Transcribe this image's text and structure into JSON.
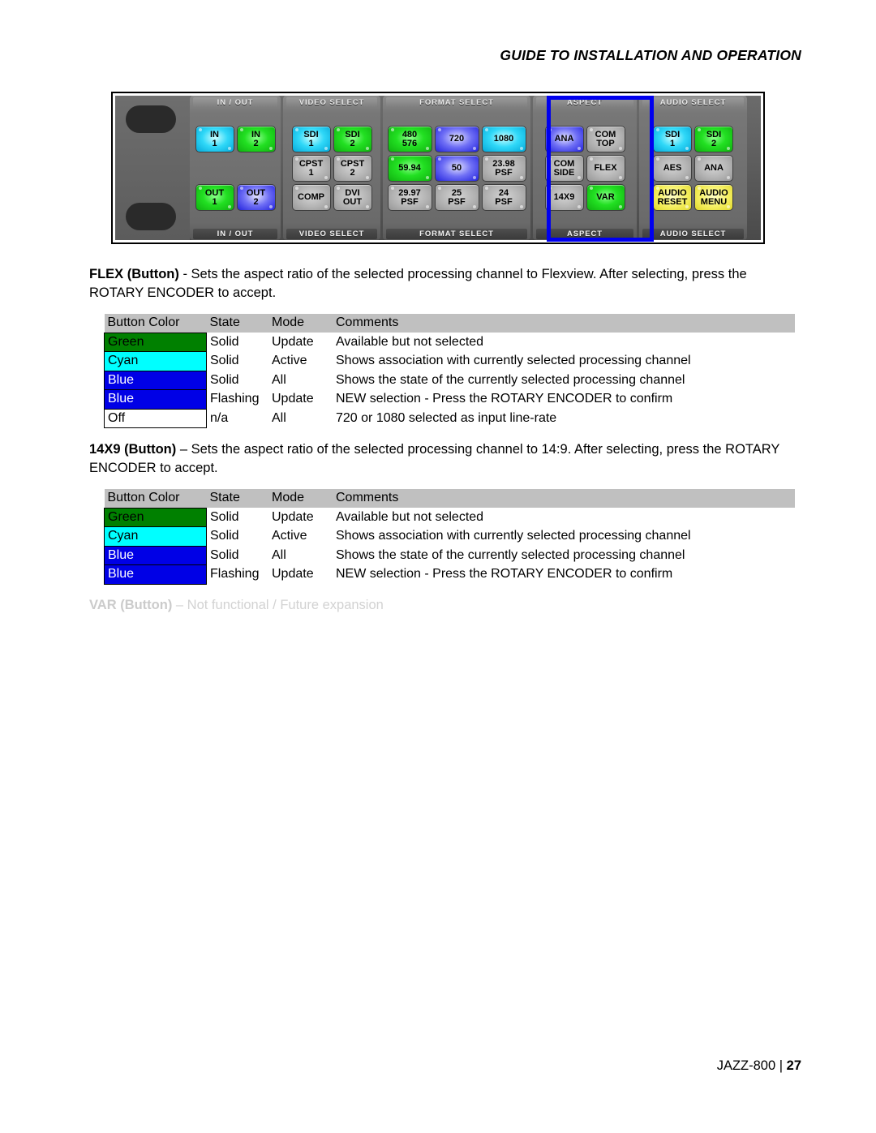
{
  "header": {
    "title": "GUIDE TO INSTALLATION AND OPERATION"
  },
  "footer": {
    "product": "JAZZ-800",
    "separator": "|",
    "page_number": "27"
  },
  "panel": {
    "highlighted_group": "ASPECT",
    "highlight_color": "#0000ee",
    "groups": [
      {
        "label": "IN / OUT",
        "columns": 2,
        "buttons": [
          {
            "lines": [
              "IN",
              "1"
            ],
            "color": "cyan"
          },
          {
            "lines": [
              "IN",
              "2"
            ],
            "color": "green"
          },
          {
            "lines": [],
            "color": "blank"
          },
          {
            "lines": [],
            "color": "blank"
          },
          {
            "lines": [
              "OUT",
              "1"
            ],
            "color": "green"
          },
          {
            "lines": [
              "OUT",
              "2"
            ],
            "color": "blue"
          }
        ]
      },
      {
        "label": "VIDEO SELECT",
        "columns": 2,
        "buttons": [
          {
            "lines": [
              "SDI",
              "1"
            ],
            "color": "cyan"
          },
          {
            "lines": [
              "SDI",
              "2"
            ],
            "color": "green"
          },
          {
            "lines": [
              "CPST",
              "1"
            ],
            "color": "off"
          },
          {
            "lines": [
              "CPST",
              "2"
            ],
            "color": "off"
          },
          {
            "lines": [
              "COMP"
            ],
            "color": "off"
          },
          {
            "lines": [
              "DVI",
              "OUT"
            ],
            "color": "off"
          }
        ]
      },
      {
        "label": "FORMAT SELECT",
        "columns": 3,
        "buttons": [
          {
            "lines": [
              "480",
              "576"
            ],
            "color": "green"
          },
          {
            "lines": [
              "720"
            ],
            "color": "blue"
          },
          {
            "lines": [
              "1080"
            ],
            "color": "cyan"
          },
          {
            "lines": [
              "59.94"
            ],
            "color": "green"
          },
          {
            "lines": [
              "50"
            ],
            "color": "blue"
          },
          {
            "lines": [
              "23.98",
              "PSF"
            ],
            "color": "off"
          },
          {
            "lines": [
              "29.97",
              "PSF"
            ],
            "color": "off"
          },
          {
            "lines": [
              "25",
              "PSF"
            ],
            "color": "off"
          },
          {
            "lines": [
              "24",
              "PSF"
            ],
            "color": "off"
          }
        ]
      },
      {
        "label": "ASPECT",
        "columns": 2,
        "buttons": [
          {
            "lines": [
              "ANA"
            ],
            "color": "blue"
          },
          {
            "lines": [
              "COM",
              "TOP"
            ],
            "color": "off"
          },
          {
            "lines": [
              "COM",
              "SIDE"
            ],
            "color": "off"
          },
          {
            "lines": [
              "FLEX"
            ],
            "color": "off"
          },
          {
            "lines": [
              "14X9"
            ],
            "color": "off"
          },
          {
            "lines": [
              "VAR"
            ],
            "color": "green"
          }
        ]
      },
      {
        "label": "AUDIO SELECT",
        "columns": 2,
        "buttons": [
          {
            "lines": [
              "SDI",
              "1"
            ],
            "color": "cyan"
          },
          {
            "lines": [
              "SDI",
              "2"
            ],
            "color": "green"
          },
          {
            "lines": [
              "AES"
            ],
            "color": "off"
          },
          {
            "lines": [
              "ANA"
            ],
            "color": "off"
          },
          {
            "lines": [
              "AUDIO",
              "RESET"
            ],
            "color": "yellow"
          },
          {
            "lines": [
              "AUDIO",
              "MENU"
            ],
            "color": "yellow"
          }
        ]
      }
    ]
  },
  "sections": [
    {
      "id": "flex",
      "term": "FLEX (Button)",
      "body": " - Sets the aspect ratio of the selected processing channel to Flexview. After selecting, press the ROTARY ENCODER to accept.",
      "table": {
        "headers": [
          "Button Color",
          "State",
          "Mode",
          "Comments"
        ],
        "rows": [
          {
            "color_label": "Green",
            "swatch": "green",
            "state": "Solid",
            "mode": "Update",
            "comments": "Available but not selected"
          },
          {
            "color_label": "Cyan",
            "swatch": "cyan",
            "state": "Solid",
            "mode": "Active",
            "comments": "Shows association with currently selected processing channel"
          },
          {
            "color_label": "Blue",
            "swatch": "blue",
            "state": "Solid",
            "mode": "All",
            "comments": "Shows the state of the currently selected processing channel"
          },
          {
            "color_label": "Blue",
            "swatch": "blue",
            "state": "Flashing",
            "mode": "Update",
            "comments": "NEW selection - Press the ROTARY ENCODER to confirm"
          },
          {
            "color_label": "Off",
            "swatch": "off",
            "state": "n/a",
            "mode": "All",
            "comments": "720 or 1080 selected as input line-rate"
          }
        ]
      }
    },
    {
      "id": "14x9",
      "term": "14X9 (Button)",
      "body": " – Sets the aspect ratio of the selected processing channel to 14:9. After selecting, press the ROTARY ENCODER to accept.",
      "table": {
        "headers": [
          "Button Color",
          "State",
          "Mode",
          "Comments"
        ],
        "rows": [
          {
            "color_label": "Green",
            "swatch": "green",
            "state": "Solid",
            "mode": "Update",
            "comments": "Available but not selected"
          },
          {
            "color_label": "Cyan",
            "swatch": "cyan",
            "state": "Solid",
            "mode": "Active",
            "comments": "Shows association with currently selected processing channel"
          },
          {
            "color_label": "Blue",
            "swatch": "blue",
            "state": "Solid",
            "mode": "All",
            "comments": "Shows the state of the currently selected processing channel"
          },
          {
            "color_label": "Blue",
            "swatch": "blue",
            "state": "Flashing",
            "mode": "Update",
            "comments": "NEW selection - Press the ROTARY ENCODER to confirm"
          }
        ]
      }
    }
  ],
  "var_note": {
    "term": "VAR (Button)",
    "body": " – Not functional / Future expansion"
  }
}
